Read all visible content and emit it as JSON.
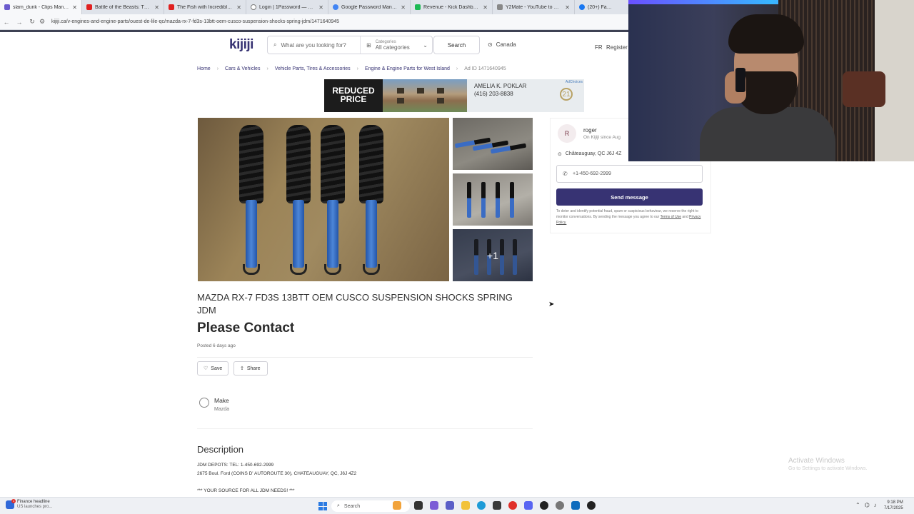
{
  "browser": {
    "tabs": [
      {
        "label": "slam_dunk - Clips Manager",
        "color": "#6a5acd"
      },
      {
        "label": "Battle of the Beasts: The Fight",
        "color": "#e02020"
      },
      {
        "label": "The Fish with Incredible Shock",
        "color": "#e02020"
      },
      {
        "label": "Login | 1Password — Password",
        "color": "#555555"
      },
      {
        "label": "Google Password Manager",
        "color": "#4285f4"
      },
      {
        "label": "Revenue - Kick Dashboard",
        "color": "#1db954"
      },
      {
        "label": "Y2Mate - YouTube to MP3 Co",
        "color": "#888888"
      },
      {
        "label": "(20+) Facebook",
        "color": "#1877f2"
      }
    ],
    "url": "kijiji.ca/v-engines-and-engine-parts/ouest-de-lile-qc/mazda-rx-7-fd3s-13btt-oem-cusco-suspension-shocks-spring-jdm/1471640945"
  },
  "header": {
    "logo": "kijiji",
    "search_placeholder": "What are you looking for?",
    "categories_small": "Categories",
    "categories_value": "All categories",
    "search_button": "Search",
    "location": "Canada",
    "lang": "FR",
    "register": "Register"
  },
  "breadcrumb": {
    "items": [
      "Home",
      "Cars & Vehicles",
      "Vehicle Parts, Tires & Accessories",
      "Engine & Engine Parts for West Island"
    ],
    "ad_id": "Ad ID 1471640945"
  },
  "ad_banner": {
    "headline": "REDUCED PRICE",
    "agent_name": "AMELIA K. POKLAR",
    "agent_phone": "(416) 203-8838",
    "logo_text": "21",
    "adchoices": "AdChoices"
  },
  "photos": {
    "more_count": "+1"
  },
  "listing": {
    "title": "MAZDA RX-7 FD3S 13BTT OEM CUSCO SUSPENSION SHOCKS SPRING JDM",
    "price": "Please Contact",
    "posted": "Posted 6 days ago",
    "save_label": "Save",
    "share_label": "Share",
    "attribute_label": "Make",
    "attribute_value": "Mazda",
    "description_title": "Description",
    "description_lines": [
      "JDM DEPOTS: TEL: 1-450-692-2999",
      "2675 Boul. Ford (COINS D' AUTOROUTE 30), CHATEAUGUAY, QC, J6J 4Z2",
      "*** YOUR SOURCE FOR ALL JDM NEEDS! ***"
    ]
  },
  "seller": {
    "avatar_letter": "R",
    "name": "roger",
    "since": "On Kijiji since Aug",
    "location": "Châteauguay, QC J6J 4Z",
    "phone": "+1-450-692-2999",
    "send_button": "Send message",
    "disclaimer": "To deter and identify potential fraud, spam or suspicious behaviour, we reserve the right to monitor conversations. By sending the message you agree to our",
    "terms": "Terms of Use",
    "and": "and",
    "privacy": "Privacy Policy."
  },
  "os": {
    "watermark_title": "Activate Windows",
    "watermark_sub": "Go to Settings to activate Windows.",
    "news_title": "Finance headline",
    "news_sub": "US launches pro...",
    "news_count": "1",
    "search_label": "Search",
    "time": "9:18 PM",
    "date": "7/17/2025"
  }
}
